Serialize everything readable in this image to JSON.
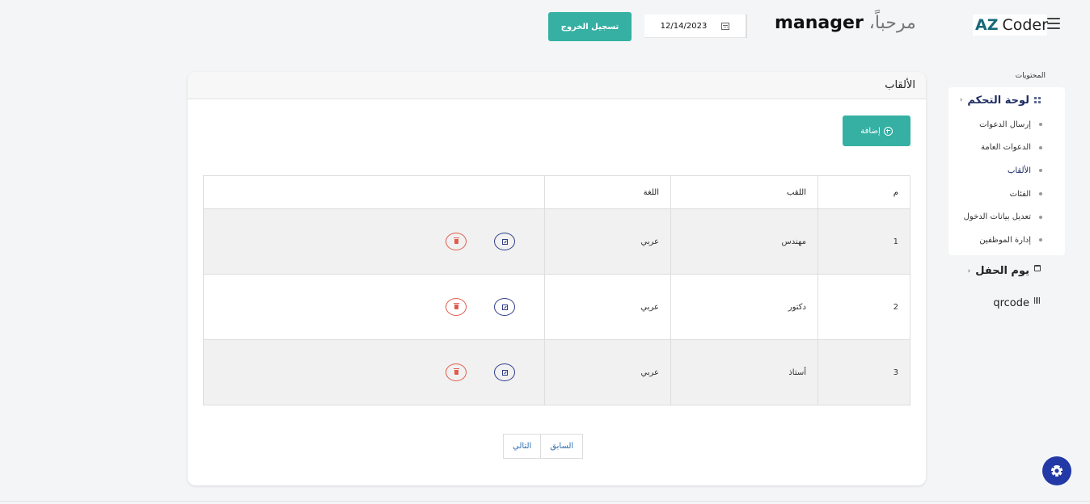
{
  "header": {
    "logo_az": "AZ",
    "logo_coder": "Coder",
    "welcome": "مرحباً، ",
    "username": "manager",
    "date": "12/14/2023",
    "logout_label": "تسجيل الخروج"
  },
  "sidebar": {
    "section_label": "المحتويات",
    "dashboard": {
      "label": "لوحة التحكم",
      "icon": "grid-icon",
      "items": [
        {
          "label": "إرسال الدعوات"
        },
        {
          "label": "الدعوات العامة"
        },
        {
          "label": "الألقاب"
        },
        {
          "label": "الفئات"
        },
        {
          "label": "تعديل بيانات الدخول"
        },
        {
          "label": "إدارة الموظفين"
        }
      ]
    },
    "party_day": {
      "label": "يوم الحفل",
      "icon": "calendar-icon"
    },
    "qrcode": {
      "label": "qrcode",
      "icon": "barcode-icon"
    }
  },
  "main": {
    "title": "الألقاب",
    "add_label": "إضافة",
    "table": {
      "headers": [
        "م",
        "اللقب",
        "اللغة",
        ""
      ],
      "rows": [
        {
          "num": "1",
          "title": "مهندس",
          "language": "عربي"
        },
        {
          "num": "2",
          "title": "دكتور",
          "language": "عربي"
        },
        {
          "num": "3",
          "title": "أستاذ",
          "language": "عربي"
        }
      ]
    },
    "pagination": {
      "next": "التالي",
      "prev": "السابق"
    }
  },
  "colors": {
    "accent": "#35b0a3",
    "nav_text": "#1f2e63",
    "fab": "#2239a6",
    "edit": "#2d3c8a",
    "delete": "#e05b4b"
  }
}
